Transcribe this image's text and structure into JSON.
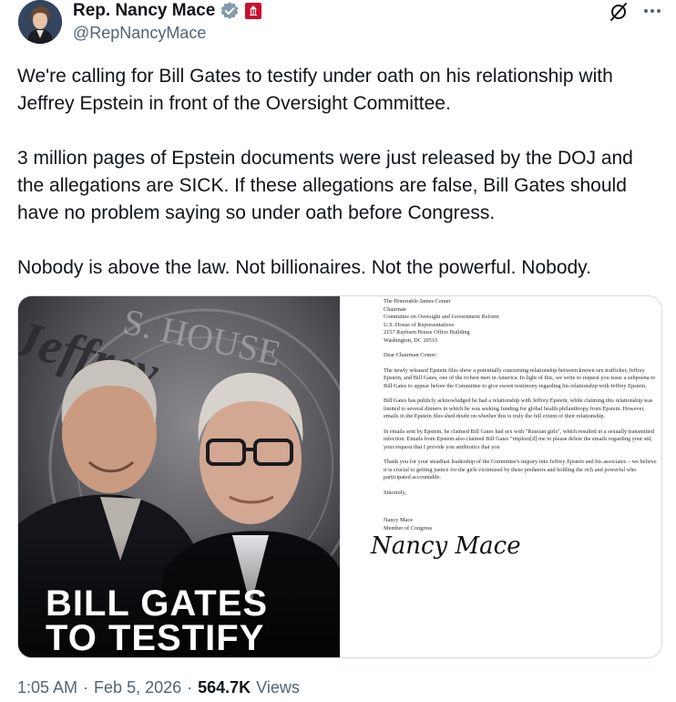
{
  "author": {
    "display_name": "Rep. Nancy Mace",
    "handle": "@RepNancyMace"
  },
  "icons": {
    "verified": "verified-badge-icon",
    "affiliation": "us-house-badge-icon",
    "grok": "grok-icon",
    "more": "more-icon"
  },
  "tweet": {
    "paragraphs": [
      "We're calling for Bill Gates to testify under oath on his relationship with Jeffrey Epstein in front of the Oversight Committee.",
      "3 million pages of Epstein documents were just released by the DOJ and the allegations are SICK. If these allegations are false, Bill Gates should have no problem saying so under oath before Congress.",
      "Nobody is above the law. Not billionaires. Not the powerful. Nobody."
    ]
  },
  "media": {
    "headline_line1": "BILL GATES",
    "headline_line2": "TO TESTIFY",
    "background_text": "Jeffrey",
    "seal_text": "S. HOUSE",
    "letter": {
      "address": [
        "The Honorable James Comer",
        "Chairman",
        "Committee on Oversight and Government Reform",
        "U.S. House of Representatives",
        "2157 Rayburn House Office Building",
        "Washington, DC 20515"
      ],
      "salutation": "Dear Chairman Comer:",
      "para1": "The newly released Epstein files show a potentially concerning relationship between known sex trafficker, Jeffrey Epstein, and Bill Gates, one of the richest men in America. In light of this, we write to request you issue a subpoena to Bill Gates to appear before the Committee to give sworn testimony regarding his relationship with Jeffrey Epstein.",
      "para2": "Bill Gates has publicly acknowledged he had a relationship with Jeffrey Epstein, while claiming this relationship was limited to several dinners in which he was seeking funding for global health philanthropy from Epstein. However, emails in the Epstein files shed doubt on whether this is truly the full extent of their relationship.",
      "para3": "In emails sent by Epstein, he claimed Bill Gates had sex with \"Russian girls\", which resulted in a sexually transmitted infection. Emails from Epstein also claimed Bill Gates \"implore[d] me to please delete the emails regarding your std, your request that I provide you antibiotics that you",
      "para4": "Thank you for your steadfast leadership of the Committee's inquiry into Jeffrey Epstein and his associates – we believe it is crucial to getting justice for the girls victimized by these predators and holding the rich and powerful who participated accountable.",
      "closing": "Sincerely,",
      "signature": "Nancy Mace",
      "signer_name": "Nancy Mace",
      "signer_title": "Member of Congress"
    }
  },
  "footer": {
    "time": "1:05 AM",
    "separator1": "·",
    "date": "Feb 5, 2026",
    "separator2": "·",
    "views_count": "564.7K",
    "views_label": "Views"
  }
}
